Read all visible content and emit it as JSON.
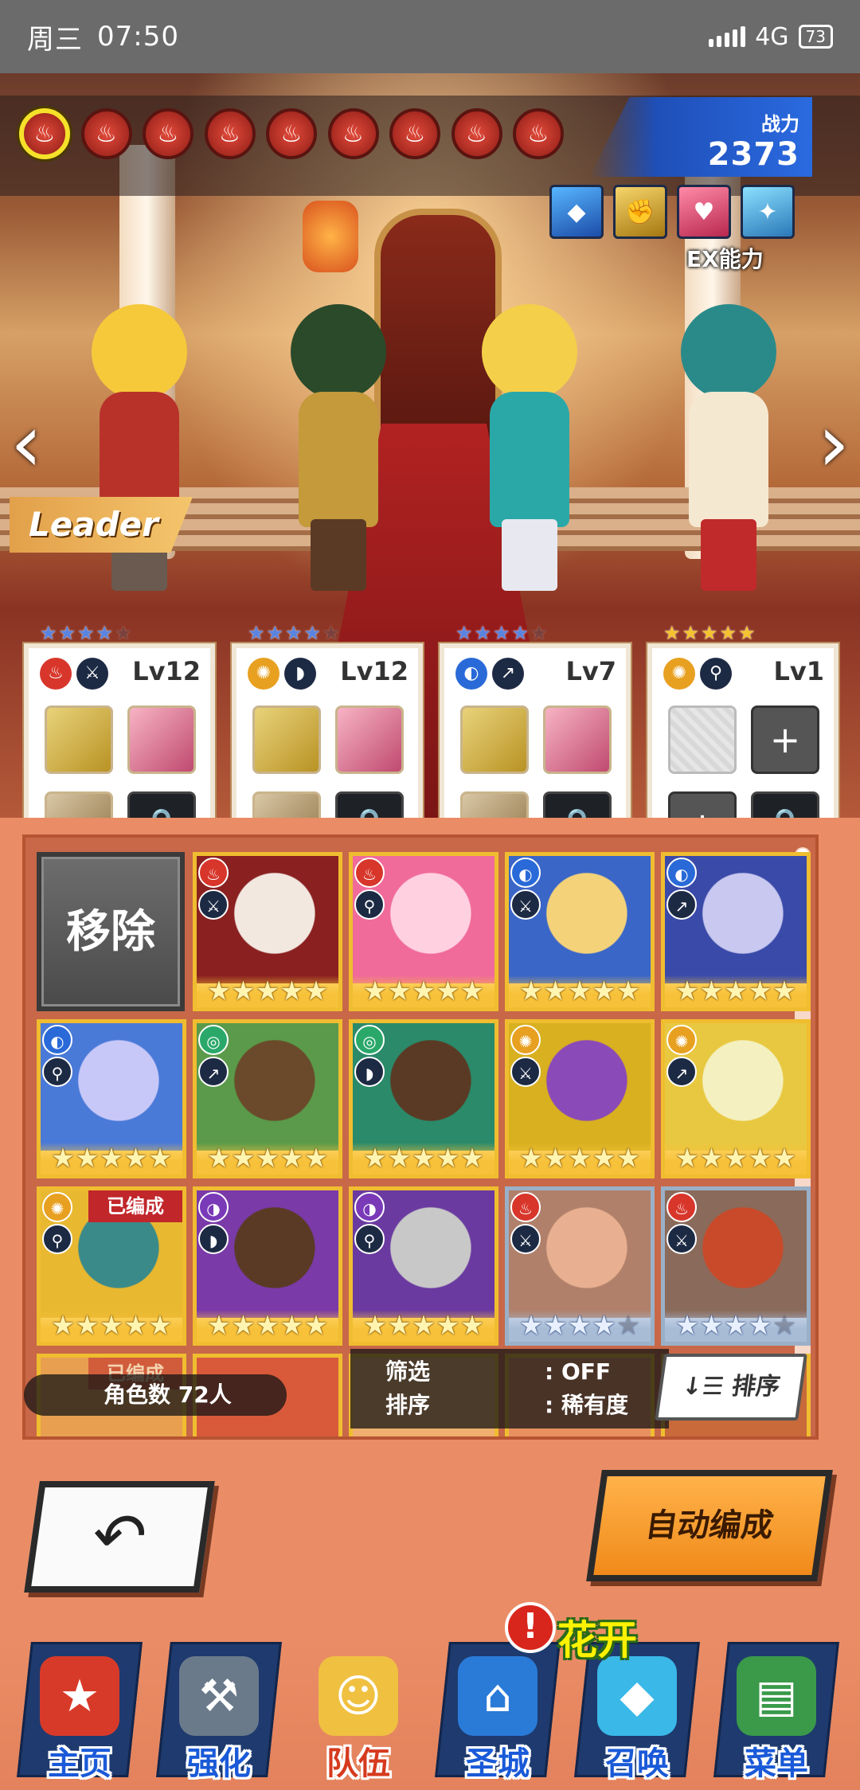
{
  "status_bar": {
    "day": "周三",
    "time": "07:50",
    "network": "4G",
    "battery": "73"
  },
  "scene": {
    "power_label": "战力",
    "power_value": "2373",
    "ex_label": "EX能力",
    "leader_label": "Leader",
    "element_filters": [
      "fire",
      "fire",
      "fire",
      "fire",
      "fire",
      "fire",
      "fire",
      "fire",
      "fire"
    ],
    "selected_filter_index": 0
  },
  "party": [
    {
      "level": "Lv12",
      "stars": 4,
      "star_color": "blue",
      "element": "fire",
      "weapon": "sword"
    },
    {
      "level": "Lv12",
      "stars": 4,
      "star_color": "blue",
      "element": "light",
      "weapon": "bow"
    },
    {
      "level": "Lv7",
      "stars": 4,
      "star_color": "blue",
      "element": "water",
      "weapon": "lance"
    },
    {
      "level": "Lv1",
      "stars": 5,
      "star_color": "gold",
      "element": "light",
      "weapon": "staff"
    }
  ],
  "roster": {
    "remove_label": "移除",
    "units": [
      {
        "element": "fire",
        "weapon": "sword",
        "stars": 5,
        "tier": "gold",
        "colors": [
          "#8a2020",
          "#f2e8e0"
        ]
      },
      {
        "element": "fire",
        "weapon": "staff",
        "stars": 5,
        "tier": "gold",
        "colors": [
          "#f06a9a",
          "#ffd0e0"
        ]
      },
      {
        "element": "water",
        "weapon": "sword",
        "stars": 5,
        "tier": "gold",
        "colors": [
          "#3a66c8",
          "#f4d27a"
        ]
      },
      {
        "element": "water",
        "weapon": "lance",
        "stars": 5,
        "tier": "gold",
        "colors": [
          "#3a4aa8",
          "#c8c8f0"
        ]
      },
      {
        "element": "water",
        "weapon": "staff",
        "stars": 5,
        "tier": "gold",
        "colors": [
          "#4a7ad8",
          "#c8c8f8"
        ]
      },
      {
        "element": "wind",
        "weapon": "lance",
        "stars": 5,
        "tier": "gold",
        "colors": [
          "#5a9a4a",
          "#6a4a2a"
        ]
      },
      {
        "element": "wind",
        "weapon": "bow",
        "stars": 5,
        "tier": "gold",
        "colors": [
          "#2a8a6a",
          "#5a3a24"
        ]
      },
      {
        "element": "light",
        "weapon": "sword",
        "stars": 5,
        "tier": "gold",
        "colors": [
          "#d8b020",
          "#8a4ab8"
        ]
      },
      {
        "element": "light",
        "weapon": "lance",
        "stars": 5,
        "tier": "gold",
        "colors": [
          "#e8c840",
          "#f4f0c0"
        ]
      },
      {
        "element": "light",
        "weapon": "staff",
        "stars": 5,
        "tier": "gold",
        "colors": [
          "#e8b830",
          "#3a8a8a"
        ],
        "badge": "已编成"
      },
      {
        "element": "shadow",
        "weapon": "bow",
        "stars": 5,
        "tier": "gold",
        "colors": [
          "#7a3aa8",
          "#5a3a24"
        ]
      },
      {
        "element": "shadow",
        "weapon": "staff",
        "stars": 5,
        "tier": "gold",
        "colors": [
          "#6a3aa0",
          "#c8c8c8"
        ]
      },
      {
        "element": "fire",
        "weapon": "sword",
        "stars": 4,
        "tier": "blue",
        "colors": [
          "#b0806a",
          "#e8b090"
        ]
      },
      {
        "element": "fire",
        "weapon": "sword",
        "stars": 4,
        "tier": "blue",
        "colors": [
          "#8a6a5a",
          "#c84a2a"
        ]
      }
    ],
    "partial_badge": "已编成"
  },
  "info": {
    "count_label": "角色数",
    "count_value": "72人"
  },
  "filter": {
    "filter_label": "筛选",
    "filter_value": ": OFF",
    "sort_label": "排序",
    "sort_value": ": 稀有度"
  },
  "sort_button": "排序",
  "auto_button": "自动编成",
  "nav": [
    {
      "label": "主页",
      "icon": "home-icon"
    },
    {
      "label": "强化",
      "icon": "hammer-icon"
    },
    {
      "label": "队伍",
      "icon": "party-icon"
    },
    {
      "label": "圣城",
      "icon": "castle-icon"
    },
    {
      "label": "召唤",
      "icon": "crystal-icon"
    },
    {
      "label": "菜单",
      "icon": "book-icon"
    }
  ],
  "event_banner": "花开"
}
